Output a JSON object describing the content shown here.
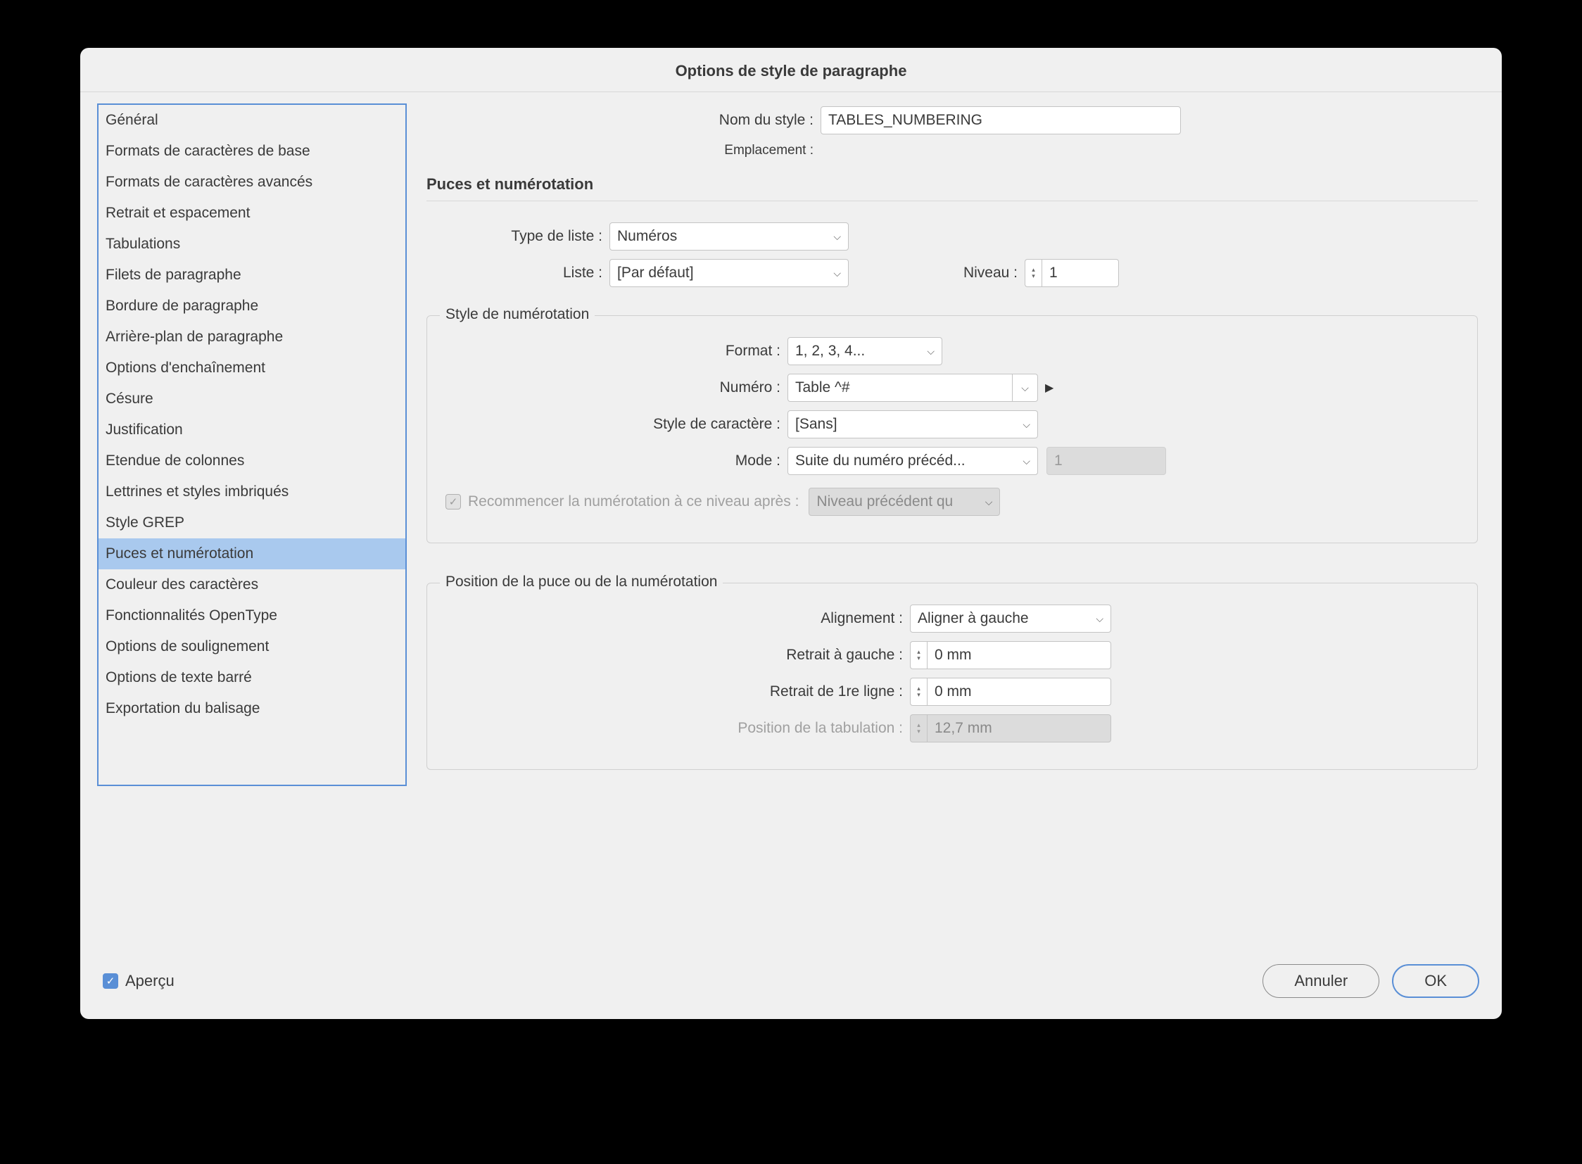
{
  "dialog": {
    "title": "Options de style de paragraphe"
  },
  "sidebar": {
    "items": [
      "Général",
      "Formats de caractères de base",
      "Formats de caractères avancés",
      "Retrait et espacement",
      "Tabulations",
      "Filets de paragraphe",
      "Bordure de paragraphe",
      "Arrière-plan de paragraphe",
      "Options d'enchaînement",
      "Césure",
      "Justification",
      "Etendue de colonnes",
      "Lettrines et styles imbriqués",
      "Style GREP",
      "Puces et numérotation",
      "Couleur des caractères",
      "Fonctionnalités OpenType",
      "Options de soulignement",
      "Options de texte barré",
      "Exportation du balisage"
    ],
    "selected_index": 14
  },
  "header": {
    "style_name_label": "Nom du style :",
    "style_name_value": "TABLES_NUMBERING",
    "location_label": "Emplacement :"
  },
  "section_title": "Puces et numérotation",
  "list_type": {
    "label": "Type de liste :",
    "value": "Numéros"
  },
  "list": {
    "label": "Liste :",
    "value": "[Par défaut]"
  },
  "level": {
    "label": "Niveau :",
    "value": "1"
  },
  "numbering_style": {
    "legend": "Style de numérotation",
    "format_label": "Format :",
    "format_value": "1, 2, 3, 4...",
    "number_label": "Numéro :",
    "number_value": "Table ^#",
    "char_style_label": "Style de caractère :",
    "char_style_value": "[Sans]",
    "mode_label": "Mode :",
    "mode_value": "Suite du numéro précéd...",
    "mode_number": "1",
    "restart_label": "Recommencer la numérotation à ce niveau après :",
    "restart_value": "Niveau précédent qu"
  },
  "position": {
    "legend": "Position de la puce ou de la numérotation",
    "alignment_label": "Alignement :",
    "alignment_value": "Aligner à gauche",
    "left_indent_label": "Retrait à gauche :",
    "left_indent_value": "0 mm",
    "first_line_label": "Retrait de 1re ligne :",
    "first_line_value": "0 mm",
    "tab_pos_label": "Position de la tabulation :",
    "tab_pos_value": "12,7 mm"
  },
  "footer": {
    "preview_label": "Aperçu",
    "cancel": "Annuler",
    "ok": "OK"
  }
}
